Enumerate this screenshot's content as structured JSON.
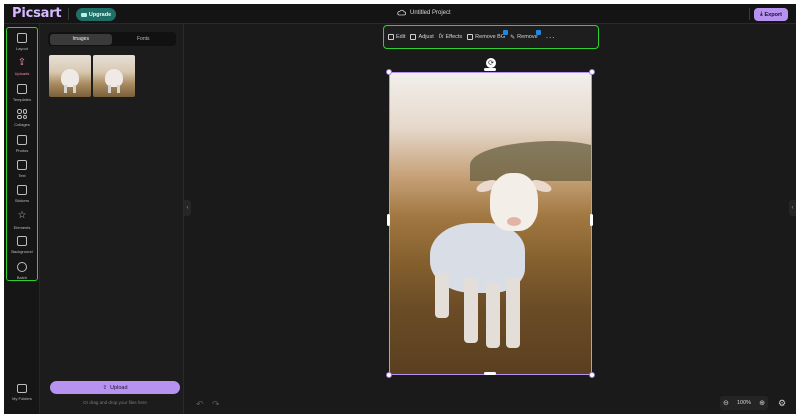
{
  "header": {
    "logo": "Picsart",
    "upgrade_label": "Upgrade",
    "project_title": "Untitled Project",
    "export_label": "Export"
  },
  "rail": {
    "items": [
      {
        "label": "Layout",
        "icon": "layout-icon"
      },
      {
        "label": "Uploads",
        "icon": "upload-icon",
        "active": true
      },
      {
        "label": "Templates",
        "icon": "templates-icon"
      },
      {
        "label": "Collages",
        "icon": "collages-icon"
      },
      {
        "label": "Photos",
        "icon": "photos-icon"
      },
      {
        "label": "Text",
        "icon": "text-icon"
      },
      {
        "label": "Stickers",
        "icon": "stickers-icon"
      },
      {
        "label": "Elements",
        "icon": "elements-icon"
      },
      {
        "label": "Background",
        "icon": "background-icon"
      },
      {
        "label": "Batch",
        "icon": "batch-icon"
      }
    ],
    "my_folders": "My Folders",
    "highlight_color": "#2ed12e",
    "active_color": "#f08ab6"
  },
  "panel": {
    "tabs": [
      "Images",
      "Fonts"
    ],
    "active_tab": "Images",
    "upload_label": "Upload",
    "upload_hint": "Or drag and drop your files here"
  },
  "toolbar": {
    "edit": "Edit",
    "adjust": "Adjust",
    "effects": "Effects",
    "remove_bg": "Remove BG",
    "remove": "Remove",
    "more": "···"
  },
  "footer": {
    "zoom": "100%"
  },
  "colors": {
    "accent": "#b792f0",
    "upgrade": "#1f6f67",
    "background": "#1a1a1a"
  }
}
